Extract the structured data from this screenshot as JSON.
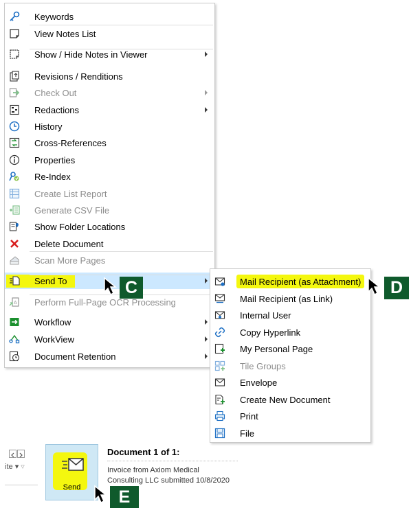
{
  "context_menu": {
    "items": [
      {
        "label": "Keywords",
        "icon": "key-icon",
        "submenu": false,
        "disabled": false
      },
      {
        "label": "View Notes List",
        "icon": "note-icon",
        "submenu": false,
        "disabled": false
      },
      {
        "label": "Show / Hide Notes in Viewer",
        "icon": "note-toggle-icon",
        "submenu": true,
        "disabled": false
      },
      {
        "label": "Revisions / Renditions",
        "icon": "revisions-icon",
        "submenu": false,
        "disabled": false
      },
      {
        "label": "Check Out",
        "icon": "check-out-icon",
        "submenu": true,
        "disabled": true
      },
      {
        "label": "Redactions",
        "icon": "redactions-icon",
        "submenu": true,
        "disabled": false
      },
      {
        "label": "History",
        "icon": "history-icon",
        "submenu": false,
        "disabled": false
      },
      {
        "label": "Cross-References",
        "icon": "cross-references-icon",
        "submenu": false,
        "disabled": false
      },
      {
        "label": "Properties",
        "icon": "info-icon",
        "submenu": false,
        "disabled": false
      },
      {
        "label": "Re-Index",
        "icon": "reindex-icon",
        "submenu": false,
        "disabled": false
      },
      {
        "label": "Create List Report",
        "icon": "list-report-icon",
        "submenu": false,
        "disabled": true
      },
      {
        "label": "Generate CSV File",
        "icon": "csv-icon",
        "submenu": false,
        "disabled": true
      },
      {
        "label": "Show Folder Locations",
        "icon": "folder-location-icon",
        "submenu": false,
        "disabled": false
      },
      {
        "label": "Delete Document",
        "icon": "delete-icon",
        "submenu": false,
        "disabled": false
      },
      {
        "label": "Scan More Pages",
        "icon": "scan-icon",
        "submenu": false,
        "disabled": true
      },
      {
        "label": "Send To",
        "icon": "send-to-icon",
        "submenu": true,
        "disabled": false
      },
      {
        "label": "Perform Full-Page OCR Processing",
        "icon": "ocr-icon",
        "submenu": false,
        "disabled": true
      },
      {
        "label": "Workflow",
        "icon": "workflow-icon",
        "submenu": true,
        "disabled": false
      },
      {
        "label": "WorkView",
        "icon": "workview-icon",
        "submenu": true,
        "disabled": false
      },
      {
        "label": "Document Retention",
        "icon": "retention-icon",
        "submenu": true,
        "disabled": false
      }
    ]
  },
  "send_to_submenu": {
    "items": [
      {
        "label": "Mail Recipient (as Attachment)",
        "icon": "mail-attachment-icon",
        "disabled": false
      },
      {
        "label": "Mail Recipient (as Link)",
        "icon": "mail-link-icon",
        "disabled": false
      },
      {
        "label": "Internal User",
        "icon": "internal-user-icon",
        "disabled": false
      },
      {
        "label": "Copy Hyperlink",
        "icon": "hyperlink-icon",
        "disabled": false
      },
      {
        "label": "My Personal Page",
        "icon": "personal-page-icon",
        "disabled": false
      },
      {
        "label": "Tile Groups",
        "icon": "tile-groups-icon",
        "disabled": true
      },
      {
        "label": "Envelope",
        "icon": "envelope-icon",
        "disabled": false
      },
      {
        "label": "Create New Document",
        "icon": "new-document-icon",
        "disabled": false
      },
      {
        "label": "Print",
        "icon": "print-icon",
        "disabled": false
      },
      {
        "label": "File",
        "icon": "save-file-icon",
        "disabled": false
      }
    ]
  },
  "callouts": {
    "c": "C",
    "d": "D",
    "e": "E"
  },
  "ribbon": {
    "send_label": "Send",
    "truncated_label": "ite"
  },
  "document": {
    "title": "Document 1 of 1:",
    "line1": "Invoice from Axiom Medical",
    "line2": "Consulting LLC submitted 10/8/2020"
  },
  "colors": {
    "highlight": "#f4f70f",
    "badge": "#0f5a2c",
    "hover": "#cce8ff"
  }
}
